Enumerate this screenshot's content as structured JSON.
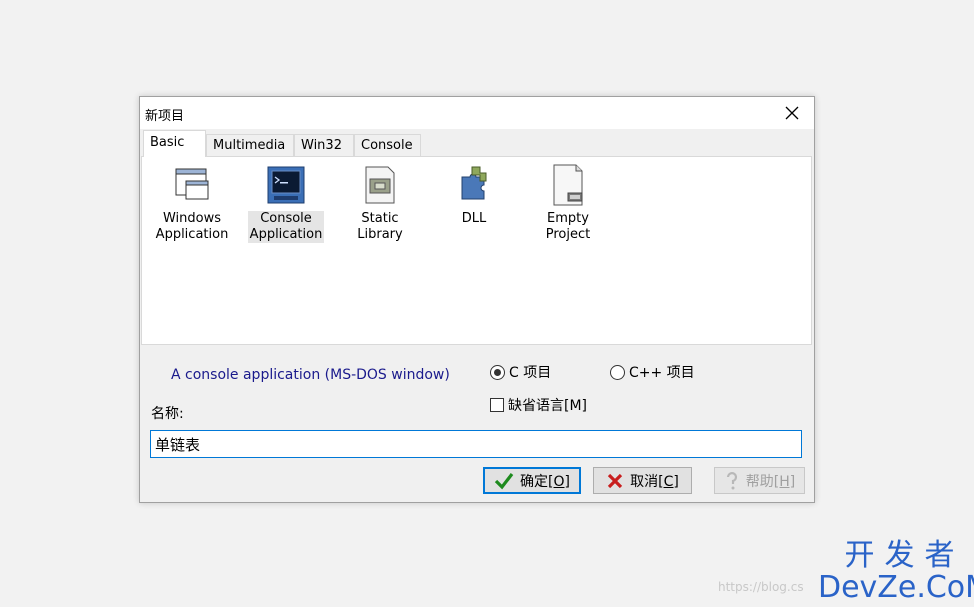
{
  "dialog": {
    "title": "新项目",
    "tabs": [
      "Basic",
      "Multimedia",
      "Win32",
      "Console"
    ],
    "items": [
      {
        "label": "Windows\nApplication",
        "icon": "window-app-icon"
      },
      {
        "label": "Console\nApplication",
        "icon": "console-app-icon"
      },
      {
        "label": "Static Library",
        "icon": "static-library-icon"
      },
      {
        "label": "DLL",
        "icon": "dll-puzzle-icon"
      },
      {
        "label": "Empty Project",
        "icon": "empty-project-icon"
      }
    ],
    "description": "A console application (MS-DOS window)",
    "radio_c": "C 项目",
    "radio_cpp": "C++ 项目",
    "checkbox_default_lang": "缺省语言[M]",
    "name_label": "名称:",
    "name_value": "单链表",
    "buttons": {
      "ok_prefix": "确定",
      "ok_key": "[O]",
      "cancel_prefix": "取消",
      "cancel_key": "[C]",
      "help_prefix": "帮助",
      "help_key": "[H]"
    }
  },
  "watermark": "https://blog.cs",
  "brand": {
    "cn": "开发者",
    "en": "DevZe.CoM"
  },
  "colors": {
    "accent": "#0078d7",
    "description": "#1a1a8c",
    "brand": "#2a63c8"
  }
}
